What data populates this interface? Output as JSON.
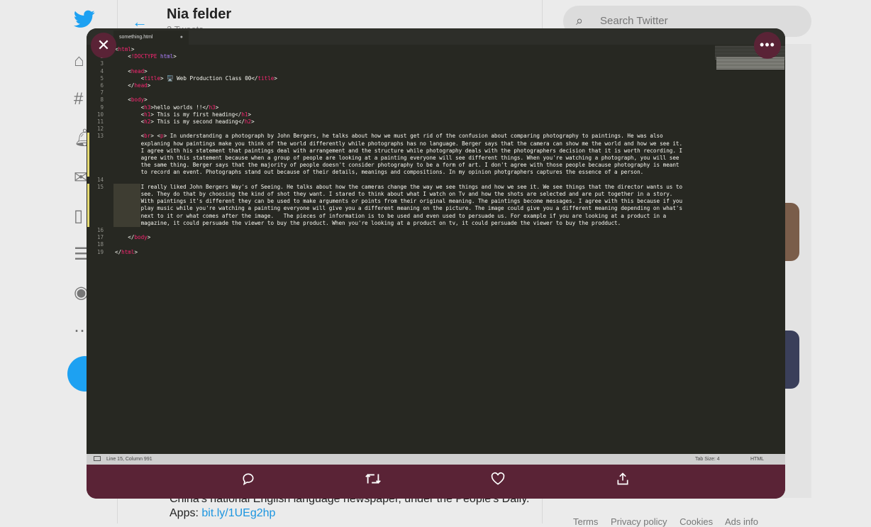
{
  "profile": {
    "name": "Nia felder",
    "tweets": "3 Tweets"
  },
  "bio": {
    "text": "China's national English language newspaper, under the People's Daily. Apps: ",
    "link": "bit.ly/1UEg2hp"
  },
  "search": {
    "placeholder": "Search Twitter"
  },
  "footer": {
    "links": [
      "Terms",
      "Privacy policy",
      "Cookies",
      "Ads info"
    ]
  },
  "editor": {
    "tab": "something.html",
    "status": {
      "position": "Line 15, Column 991",
      "tab_size": "Tab Size: 4",
      "syntax": "HTML"
    },
    "line_numbers": [
      "1",
      "2",
      "3",
      "4",
      "5",
      "6",
      "7",
      "8",
      "9",
      "10",
      "11",
      "12",
      "13",
      "14",
      "15",
      "16",
      "17",
      "18",
      "19"
    ],
    "lines": [
      "<html>",
      "    <!DOCTYPE html>",
      "",
      "    <head>",
      "        <title> 🖥️ Web Production Class 00</title>",
      "    </head>",
      "",
      "    <body>",
      "        <h3>hello worlds !!</h3>",
      "        <h1> This is my first heading</h1>",
      "        <h2> This is my second heading</h2>",
      "",
      "        <br> <p> In understanding a photograph by John Bergers, he talks about how we must get rid of the confusion about comparing photography to paintings. He was also",
      "        explaning how paintings make you think of the world differently while photographs has no language. Berger says that the camera can show me the world and how we see it.",
      "        I agree with his statement that paintings deal with arrangement and the structure while photography deals with the photographers decision that it is worth recording. I",
      "        agree with this statement because when a group of people are looking at a painting everyone will see different things. When you're watching a photograph, you will see",
      "        the same thing. Berger says that the majority of people doesn't consider photography to be a form of art. I don't agree with those people because photography is meant",
      "        to record an event. Photographs stand out because of their details, meanings and compositions. In my opinion photgraphers captures the essence of a person.",
      "",
      "        I really liked John Bergers Way's of Seeing. He talks about how the cameras change the way we see things and how we see it. We see things that the director wants us to",
      "        see. They do that by choosing the kind of shot they want. I stared to think about what I watch on Tv and how the shots are selected and are put together in a story.",
      "        With paintings it's different they can be used to make arguments or points from their original meaning. The paintings become messages. I agree with this because if you",
      "        play music while you're watching a painting everyone will give you a different meaning on the picture. The image could give you a different meaning depending on what's",
      "        next to it or what comes after the image.   The pieces of information is to be used and even used to persuade us. For example if you are looking at a product in a",
      "        magazine, it could persuade the viewer to buy the product. When you're looking at a product on tv, it could persuade the viewer to buy the prodduct.",
      "",
      "    </body>",
      "",
      "</html>"
    ]
  },
  "actions": {
    "reply": "reply-icon",
    "retweet": "retweet-icon",
    "like": "heart-icon",
    "share": "share-icon"
  },
  "colors": {
    "twitter_blue": "#1da1f2",
    "overlay_bar": "#5a2336",
    "editor_bg": "#272822",
    "tag": "#f92672"
  }
}
